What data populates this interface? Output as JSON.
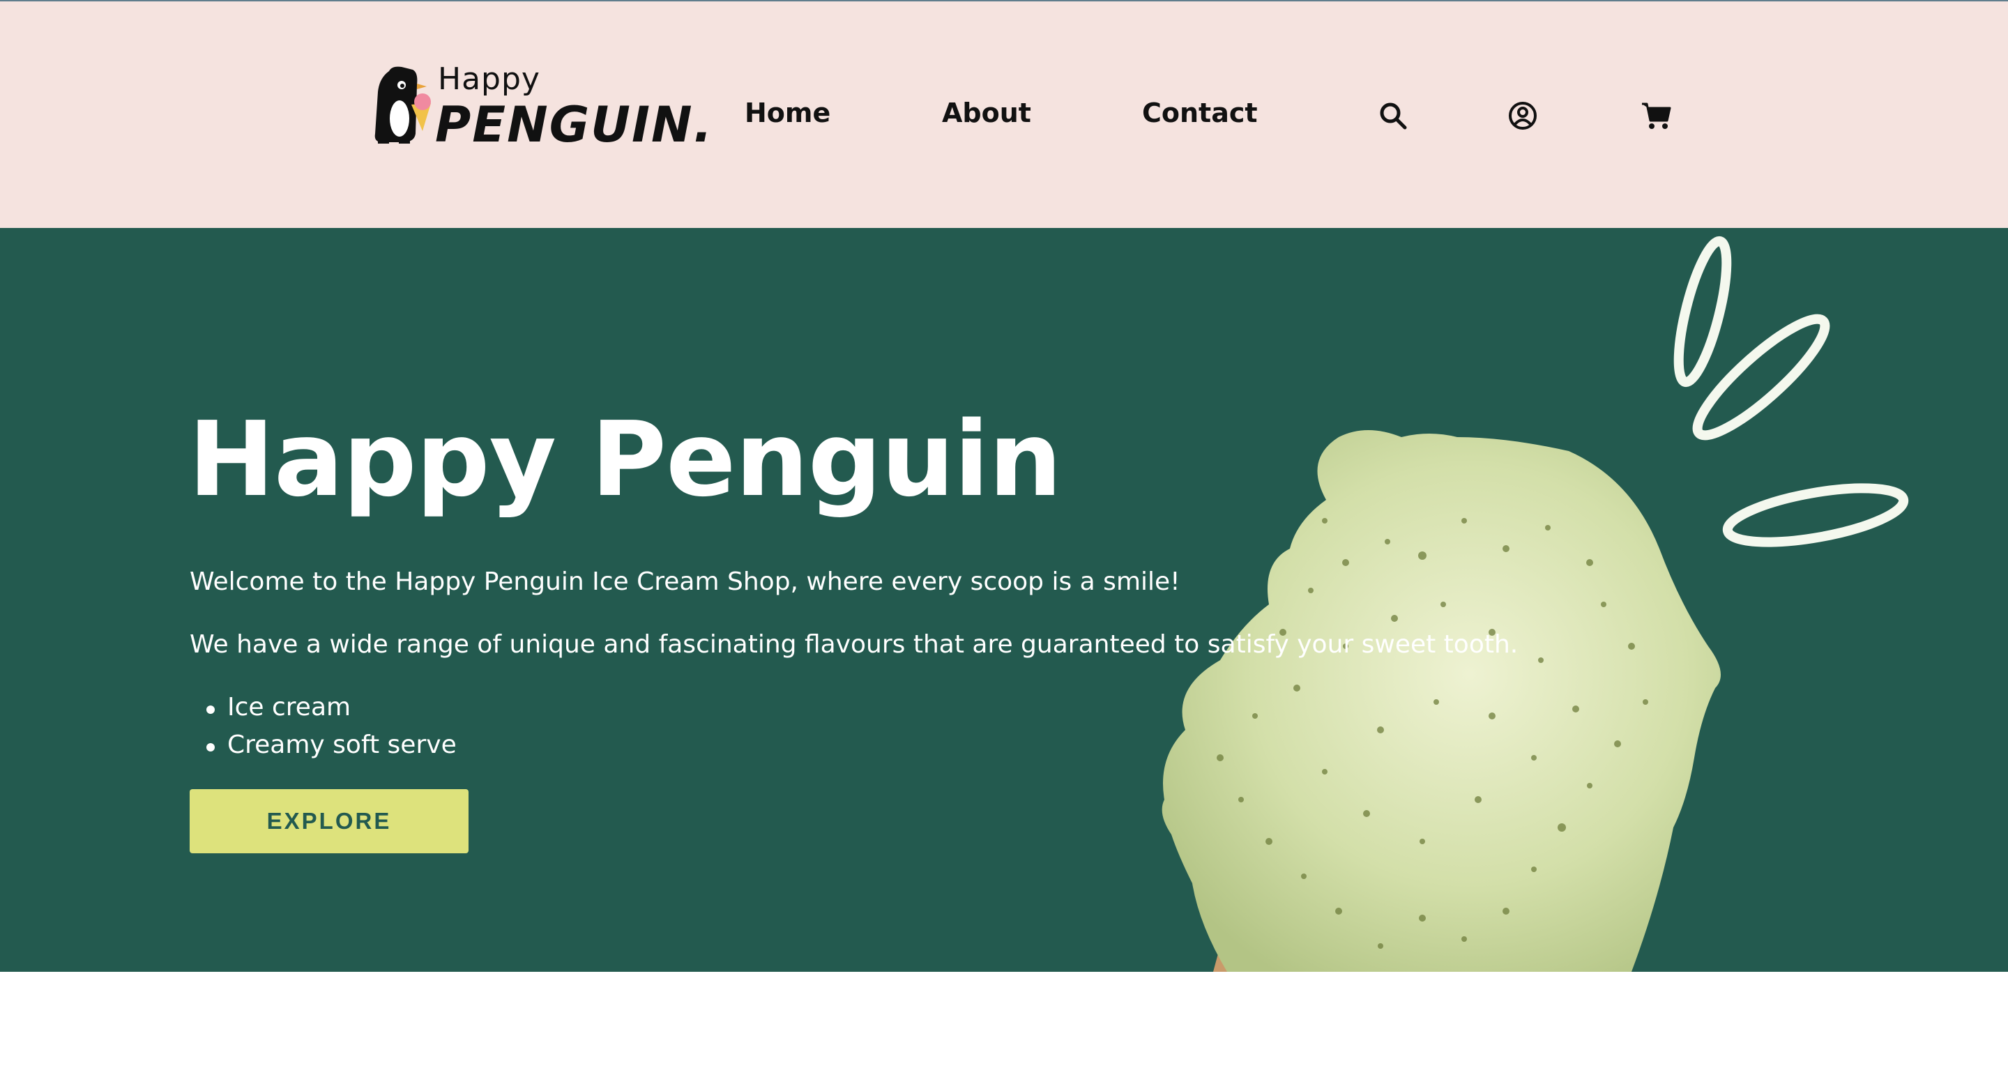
{
  "header": {
    "logo": {
      "happy": "Happy",
      "penguin": "PENGUIN."
    },
    "nav": {
      "home": "Home",
      "about": "About",
      "contact": "Contact"
    },
    "icons": [
      "search-icon",
      "account-icon",
      "cart-icon"
    ]
  },
  "hero": {
    "title": "Happy Penguin",
    "paragraphs": [
      "Welcome to the Happy Penguin Ice Cream Shop, where every scoop is a smile!",
      "We have a wide range of unique and fascinating flavours that are guaranteed to satisfy your sweet tooth."
    ],
    "list": [
      "Ice cream",
      "Creamy soft serve"
    ],
    "button": "EXPLORE"
  },
  "colors": {
    "header_bg": "#f5e3df",
    "hero_bg": "#235a4f",
    "button_bg": "#dde27c",
    "button_text": "#235a4f",
    "scoop": "#cfdca8"
  }
}
